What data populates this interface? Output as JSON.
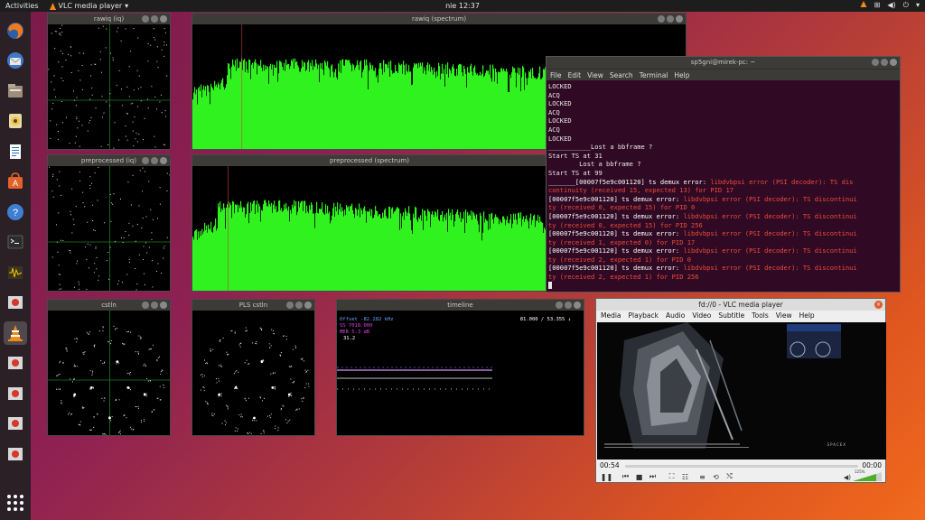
{
  "topbar": {
    "activities": "Activities",
    "app_name": "VLC media player",
    "clock": "nie 12:37"
  },
  "dock": {
    "items": [
      "firefox-icon",
      "thunderbird-icon",
      "files-icon",
      "rhythmbox-icon",
      "writer-icon",
      "software-center-icon",
      "help-icon",
      "terminal-icon",
      "oscilloscope-icon",
      "app-icon",
      "vlc-icon",
      "app-icon",
      "app-icon",
      "app-icon",
      "app-icon"
    ]
  },
  "windows": {
    "rawiq_iq": "rawiq (iq)",
    "rawiq_spectrum": "rawiq (spectrum)",
    "preprocessed_iq": "preprocessed (iq)",
    "preprocessed_spectrum": "preprocessed (spectrum)",
    "cstln": "cstln",
    "pls_cstln": "PLS cstln",
    "timeline": "timeline"
  },
  "timeline": {
    "offset": "Offset -82.282 kHz",
    "mer": "MER 5.3 dB",
    "ratio": "81.000 / 53.355 ↓",
    "line2": "SS 7018.000",
    "line4": "31.2"
  },
  "terminal": {
    "title": "sp5gni@mirek-pc: ~",
    "menu": [
      "File",
      "Edit",
      "View",
      "Search",
      "Terminal",
      "Help"
    ],
    "lines": [
      {
        "t": "LOCKED",
        "c": "n"
      },
      {
        "t": "ACQ",
        "c": "n"
      },
      {
        "t": "LOCKED",
        "c": "n"
      },
      {
        "t": "ACQ",
        "c": "n"
      },
      {
        "t": "LOCKED",
        "c": "n"
      },
      {
        "t": "ACQ",
        "c": "n"
      },
      {
        "t": "LOCKED",
        "c": "n"
      },
      {
        "t": "___________Lost a bbframe ?",
        "c": "n"
      },
      {
        "t": "Start TS at 31",
        "c": "n"
      },
      {
        "t": "        Lost a bbframe ?",
        "c": "n"
      },
      {
        "t": "Start TS at 99",
        "c": "n"
      },
      {
        "t": "_______[00007f5e9c001120] ts demux error: ",
        "c": "h",
        "r": "libdvbpsi error (PSI decoder): TS dis"
      },
      {
        "t": "",
        "c": "h",
        "r": "continuity (received 15, expected 13) for PID 17"
      },
      {
        "t": "[00007f5e9c001120] ts demux error: ",
        "c": "h",
        "r": "libdvbpsi error (PSI decoder): TS discontinui"
      },
      {
        "t": "",
        "c": "h",
        "r": "ty (received 0, expected 15) for PID 0"
      },
      {
        "t": "[00007f5e9c001120] ts demux error: ",
        "c": "h",
        "r": "libdvbpsi error (PSI decoder): TS discontinui"
      },
      {
        "t": "",
        "c": "h",
        "r": "ty (received 0, expected 15) for PID 256"
      },
      {
        "t": "[00007f5e9c001120] ts demux error: ",
        "c": "h",
        "r": "libdvbpsi error (PSI decoder): TS discontinui"
      },
      {
        "t": "",
        "c": "h",
        "r": "ty (received 1, expected 0) for PID 17"
      },
      {
        "t": "[00007f5e9c001120] ts demux error: ",
        "c": "h",
        "r": "libdvbpsi error (PSI decoder): TS discontinui"
      },
      {
        "t": "",
        "c": "h",
        "r": "ty (received 2, expected 1) for PID 0"
      },
      {
        "t": "[00007f5e9c001120] ts demux error: ",
        "c": "h",
        "r": "libdvbpsi error (PSI decoder): TS discontinui"
      },
      {
        "t": "",
        "c": "h",
        "r": "ty (received 2, expected 1) for PID 256"
      }
    ]
  },
  "vlc": {
    "title": "fd://0 - VLC media player",
    "menu": [
      "Media",
      "Playback",
      "Audio",
      "Video",
      "Subtitle",
      "Tools",
      "View",
      "Help"
    ],
    "time_elapsed": "00:54",
    "time_total": "00:00",
    "volume": "125%",
    "overlay_brand": "SPACEX"
  }
}
